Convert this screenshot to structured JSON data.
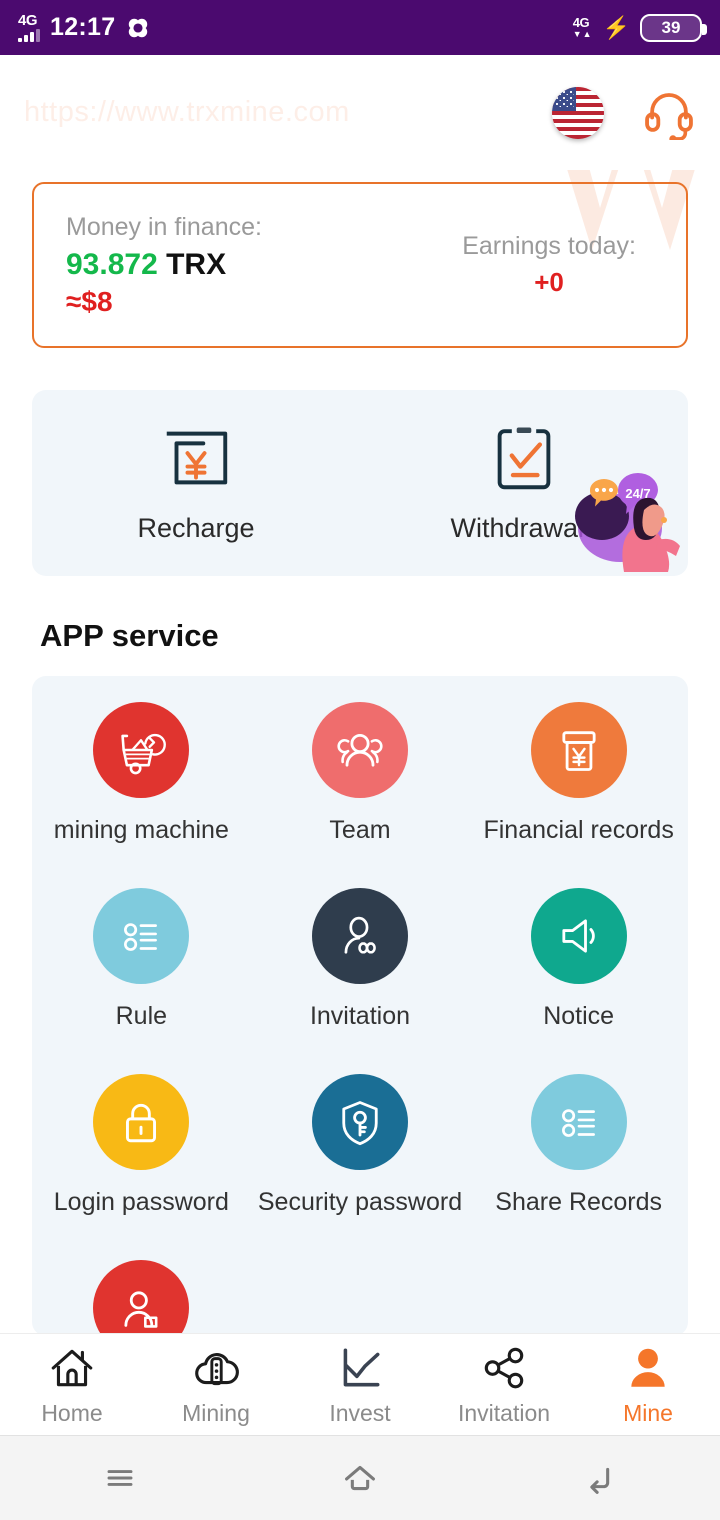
{
  "status_bar": {
    "network": "4G",
    "time": "12:17",
    "carrier_icon": "clover-icon",
    "data_network": "4G",
    "charging_icon": "lightning-bolt-icon",
    "battery_level": "39"
  },
  "header": {
    "brand_text": "https://www.trxmine.com",
    "flag_icon": "us-flag-icon",
    "support_icon": "headset-icon"
  },
  "balance_card": {
    "money_label": "Money in finance:",
    "money_value": "93.872",
    "money_unit": "TRX",
    "money_usd": "≈$8",
    "earnings_label": "Earnings today:",
    "earnings_value": "+0",
    "border_color": "#e8732a",
    "value_color": "#14b84b",
    "usd_color": "#e02020"
  },
  "quick_actions": {
    "items": [
      {
        "label": "Recharge",
        "icon": "recharge-yen-card-icon"
      },
      {
        "label": "Withdrawals",
        "icon": "withdraw-clipboard-check-icon"
      }
    ],
    "service_illustration": "customer-service-247-illustration",
    "service_badge": "24/7"
  },
  "app_service": {
    "title": "APP service",
    "items": [
      {
        "label": "mining machine",
        "icon": "mining-cart-icon",
        "color": "#e0342f"
      },
      {
        "label": "Team",
        "icon": "team-people-icon",
        "color": "#ef6d6d"
      },
      {
        "label": "Financial records",
        "icon": "atm-yen-icon",
        "color": "#ef7a3c"
      },
      {
        "label": "Rule",
        "icon": "list-rule-icon",
        "color": "#7fcbdd"
      },
      {
        "label": "Invitation",
        "icon": "person-link-icon",
        "color": "#2f3d4d"
      },
      {
        "label": "Notice",
        "icon": "speaker-notice-icon",
        "color": "#0fa88e"
      },
      {
        "label": "Login password",
        "icon": "lock-icon",
        "color": "#f8b915"
      },
      {
        "label": "Security password",
        "icon": "shield-key-icon",
        "color": "#1a6e95"
      },
      {
        "label": "Share Records",
        "icon": "list-records-icon",
        "color": "#7fcbdd"
      },
      {
        "label": "",
        "icon": "person-account-icon",
        "color": "#e0342f"
      }
    ]
  },
  "tab_bar": {
    "items": [
      {
        "label": "Home",
        "icon": "home-icon",
        "active": false
      },
      {
        "label": "Mining",
        "icon": "cloud-mining-icon",
        "active": false
      },
      {
        "label": "Invest",
        "icon": "chart-line-icon",
        "active": false
      },
      {
        "label": "Invitation",
        "icon": "share-nodes-icon",
        "active": false
      },
      {
        "label": "Mine",
        "icon": "person-icon",
        "active": true
      }
    ],
    "active_color": "#f5762a",
    "inactive_color": "#8b8b8b"
  },
  "android_nav": {
    "menu_icon": "menu-icon",
    "home_icon": "home-outline-icon",
    "back_icon": "back-arrow-icon"
  }
}
